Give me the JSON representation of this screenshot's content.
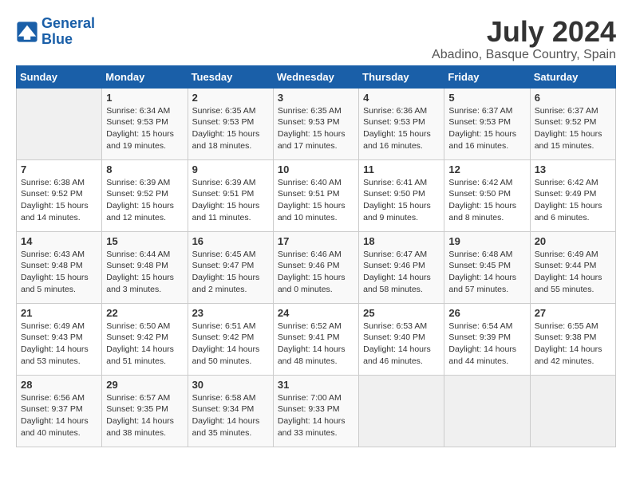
{
  "header": {
    "logo_line1": "General",
    "logo_line2": "Blue",
    "month_year": "July 2024",
    "location": "Abadino, Basque Country, Spain"
  },
  "days_of_week": [
    "Sunday",
    "Monday",
    "Tuesday",
    "Wednesday",
    "Thursday",
    "Friday",
    "Saturday"
  ],
  "weeks": [
    [
      {
        "day": "",
        "info": ""
      },
      {
        "day": "1",
        "info": "Sunrise: 6:34 AM\nSunset: 9:53 PM\nDaylight: 15 hours\nand 19 minutes."
      },
      {
        "day": "2",
        "info": "Sunrise: 6:35 AM\nSunset: 9:53 PM\nDaylight: 15 hours\nand 18 minutes."
      },
      {
        "day": "3",
        "info": "Sunrise: 6:35 AM\nSunset: 9:53 PM\nDaylight: 15 hours\nand 17 minutes."
      },
      {
        "day": "4",
        "info": "Sunrise: 6:36 AM\nSunset: 9:53 PM\nDaylight: 15 hours\nand 16 minutes."
      },
      {
        "day": "5",
        "info": "Sunrise: 6:37 AM\nSunset: 9:53 PM\nDaylight: 15 hours\nand 16 minutes."
      },
      {
        "day": "6",
        "info": "Sunrise: 6:37 AM\nSunset: 9:52 PM\nDaylight: 15 hours\nand 15 minutes."
      }
    ],
    [
      {
        "day": "7",
        "info": "Sunrise: 6:38 AM\nSunset: 9:52 PM\nDaylight: 15 hours\nand 14 minutes."
      },
      {
        "day": "8",
        "info": "Sunrise: 6:39 AM\nSunset: 9:52 PM\nDaylight: 15 hours\nand 12 minutes."
      },
      {
        "day": "9",
        "info": "Sunrise: 6:39 AM\nSunset: 9:51 PM\nDaylight: 15 hours\nand 11 minutes."
      },
      {
        "day": "10",
        "info": "Sunrise: 6:40 AM\nSunset: 9:51 PM\nDaylight: 15 hours\nand 10 minutes."
      },
      {
        "day": "11",
        "info": "Sunrise: 6:41 AM\nSunset: 9:50 PM\nDaylight: 15 hours\nand 9 minutes."
      },
      {
        "day": "12",
        "info": "Sunrise: 6:42 AM\nSunset: 9:50 PM\nDaylight: 15 hours\nand 8 minutes."
      },
      {
        "day": "13",
        "info": "Sunrise: 6:42 AM\nSunset: 9:49 PM\nDaylight: 15 hours\nand 6 minutes."
      }
    ],
    [
      {
        "day": "14",
        "info": "Sunrise: 6:43 AM\nSunset: 9:48 PM\nDaylight: 15 hours\nand 5 minutes."
      },
      {
        "day": "15",
        "info": "Sunrise: 6:44 AM\nSunset: 9:48 PM\nDaylight: 15 hours\nand 3 minutes."
      },
      {
        "day": "16",
        "info": "Sunrise: 6:45 AM\nSunset: 9:47 PM\nDaylight: 15 hours\nand 2 minutes."
      },
      {
        "day": "17",
        "info": "Sunrise: 6:46 AM\nSunset: 9:46 PM\nDaylight: 15 hours\nand 0 minutes."
      },
      {
        "day": "18",
        "info": "Sunrise: 6:47 AM\nSunset: 9:46 PM\nDaylight: 14 hours\nand 58 minutes."
      },
      {
        "day": "19",
        "info": "Sunrise: 6:48 AM\nSunset: 9:45 PM\nDaylight: 14 hours\nand 57 minutes."
      },
      {
        "day": "20",
        "info": "Sunrise: 6:49 AM\nSunset: 9:44 PM\nDaylight: 14 hours\nand 55 minutes."
      }
    ],
    [
      {
        "day": "21",
        "info": "Sunrise: 6:49 AM\nSunset: 9:43 PM\nDaylight: 14 hours\nand 53 minutes."
      },
      {
        "day": "22",
        "info": "Sunrise: 6:50 AM\nSunset: 9:42 PM\nDaylight: 14 hours\nand 51 minutes."
      },
      {
        "day": "23",
        "info": "Sunrise: 6:51 AM\nSunset: 9:42 PM\nDaylight: 14 hours\nand 50 minutes."
      },
      {
        "day": "24",
        "info": "Sunrise: 6:52 AM\nSunset: 9:41 PM\nDaylight: 14 hours\nand 48 minutes."
      },
      {
        "day": "25",
        "info": "Sunrise: 6:53 AM\nSunset: 9:40 PM\nDaylight: 14 hours\nand 46 minutes."
      },
      {
        "day": "26",
        "info": "Sunrise: 6:54 AM\nSunset: 9:39 PM\nDaylight: 14 hours\nand 44 minutes."
      },
      {
        "day": "27",
        "info": "Sunrise: 6:55 AM\nSunset: 9:38 PM\nDaylight: 14 hours\nand 42 minutes."
      }
    ],
    [
      {
        "day": "28",
        "info": "Sunrise: 6:56 AM\nSunset: 9:37 PM\nDaylight: 14 hours\nand 40 minutes."
      },
      {
        "day": "29",
        "info": "Sunrise: 6:57 AM\nSunset: 9:35 PM\nDaylight: 14 hours\nand 38 minutes."
      },
      {
        "day": "30",
        "info": "Sunrise: 6:58 AM\nSunset: 9:34 PM\nDaylight: 14 hours\nand 35 minutes."
      },
      {
        "day": "31",
        "info": "Sunrise: 7:00 AM\nSunset: 9:33 PM\nDaylight: 14 hours\nand 33 minutes."
      },
      {
        "day": "",
        "info": ""
      },
      {
        "day": "",
        "info": ""
      },
      {
        "day": "",
        "info": ""
      }
    ]
  ]
}
